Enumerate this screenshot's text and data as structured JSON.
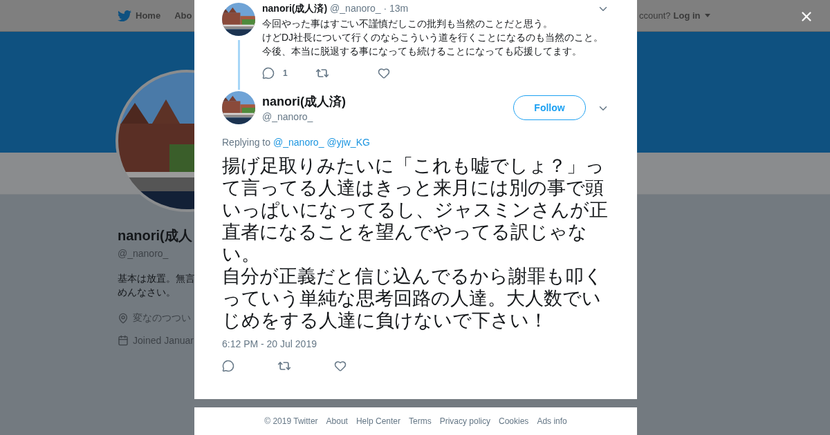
{
  "nav": {
    "items": [
      {
        "label": "Home"
      },
      {
        "label": "Abo"
      }
    ],
    "account_prompt": "ccount?",
    "login": "Log in"
  },
  "profile": {
    "name": "nanori(成人",
    "handle": "@_nanoro_",
    "bio": [
      "基本は放置。無言",
      "めんなさい。"
    ],
    "location": "変なのつつい",
    "joined": "Joined Januar"
  },
  "parent_tweet": {
    "name": "nanori(成人済)",
    "handle": "@_nanoro_",
    "time": "· 13m",
    "text": [
      "今回やった事はすごい不謹慎だしこの批判も当然のことだと思う。",
      "けどDJ社長について行くのならこういう道を行くことになるのも当然のこと。",
      "今後、本当に脱退する事になっても続けることになっても応援してます。"
    ],
    "reply_count": "1"
  },
  "tweet": {
    "name": "nanori(成人済)",
    "handle": "@_nanoro_",
    "follow": "Follow",
    "replying_to": "Replying to",
    "mentions": [
      "@_nanoro_",
      "@yjw_KG"
    ],
    "text": [
      "揚げ足取りみたいに「これも嘘でしょ？」って言ってる人達はきっと来月には別の事で頭いっぱいになってるし、ジャスミンさんが正直者になることを望んでやってる訳じゃない。",
      "自分が正義だと信じ込んでるから謝罪も叩くっていう単純な思考回路の人達。大人数でいじめをする人達に負けないで下さい！"
    ],
    "timestamp": "6:12 PM - 20 Jul 2019"
  },
  "footer": {
    "links": [
      "© 2019 Twitter",
      "About",
      "Help Center",
      "Terms",
      "Privacy policy",
      "Cookies",
      "Ads info"
    ]
  }
}
